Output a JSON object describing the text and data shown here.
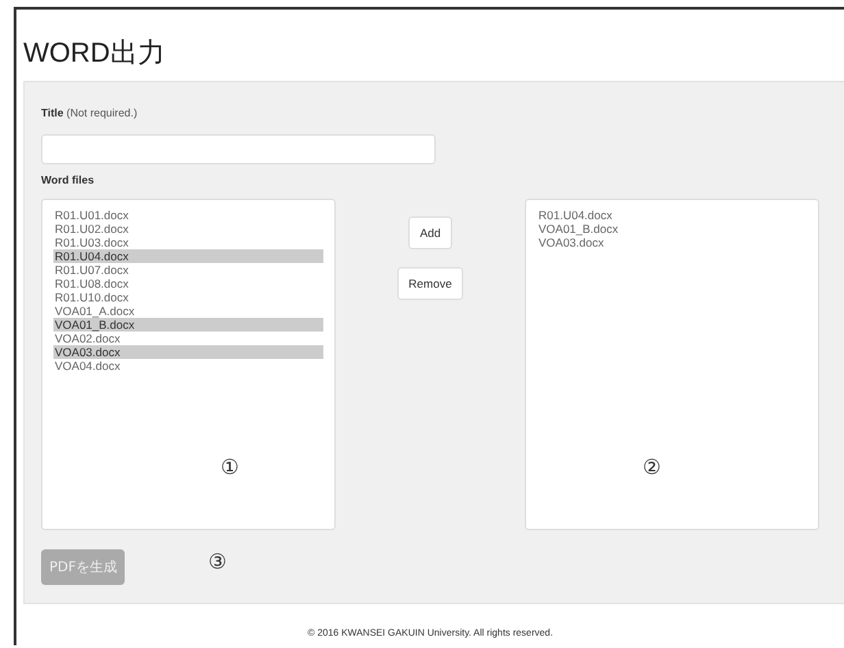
{
  "page": {
    "title": "WORD出力"
  },
  "form": {
    "title_label": "**Title** (Not required.)",
    "word_files_label": "Word files",
    "source_list": {
      "items": [
        {
          "label": "R01.U01.docx",
          "selected": false
        },
        {
          "label": "R01.U02.docx",
          "selected": false
        },
        {
          "label": "R01.U03.docx",
          "selected": false
        },
        {
          "label": "R01.U04.docx",
          "selected": true
        },
        {
          "label": "R01.U07.docx",
          "selected": false
        },
        {
          "label": "R01.U08.docx",
          "selected": false
        },
        {
          "label": "R01.U10.docx",
          "selected": false
        },
        {
          "label": "VOA01_A.docx",
          "selected": false
        },
        {
          "label": "VOA01_B.docx",
          "selected": true
        },
        {
          "label": "VOA02.docx",
          "selected": false
        },
        {
          "label": "VOA03.docx",
          "selected": true
        },
        {
          "label": "VOA04.docx",
          "selected": false
        }
      ],
      "annotation": "①"
    },
    "buttons": [
      "Add",
      "Remove"
    ],
    "target_list": {
      "items": [
        {
          "label": "R01.U04.docx",
          "selected": false
        },
        {
          "label": "VOA01_B.docx",
          "selected": false
        },
        {
          "label": "VOA03.docx",
          "selected": false
        }
      ],
      "annotation": "②"
    },
    "generate_button": {
      "label": "PDFを生成",
      "disabled": true
    },
    "generate_annotation": "③"
  },
  "footer": "© 2016 KWANSEI GAKUIN University. All rights reserved."
}
